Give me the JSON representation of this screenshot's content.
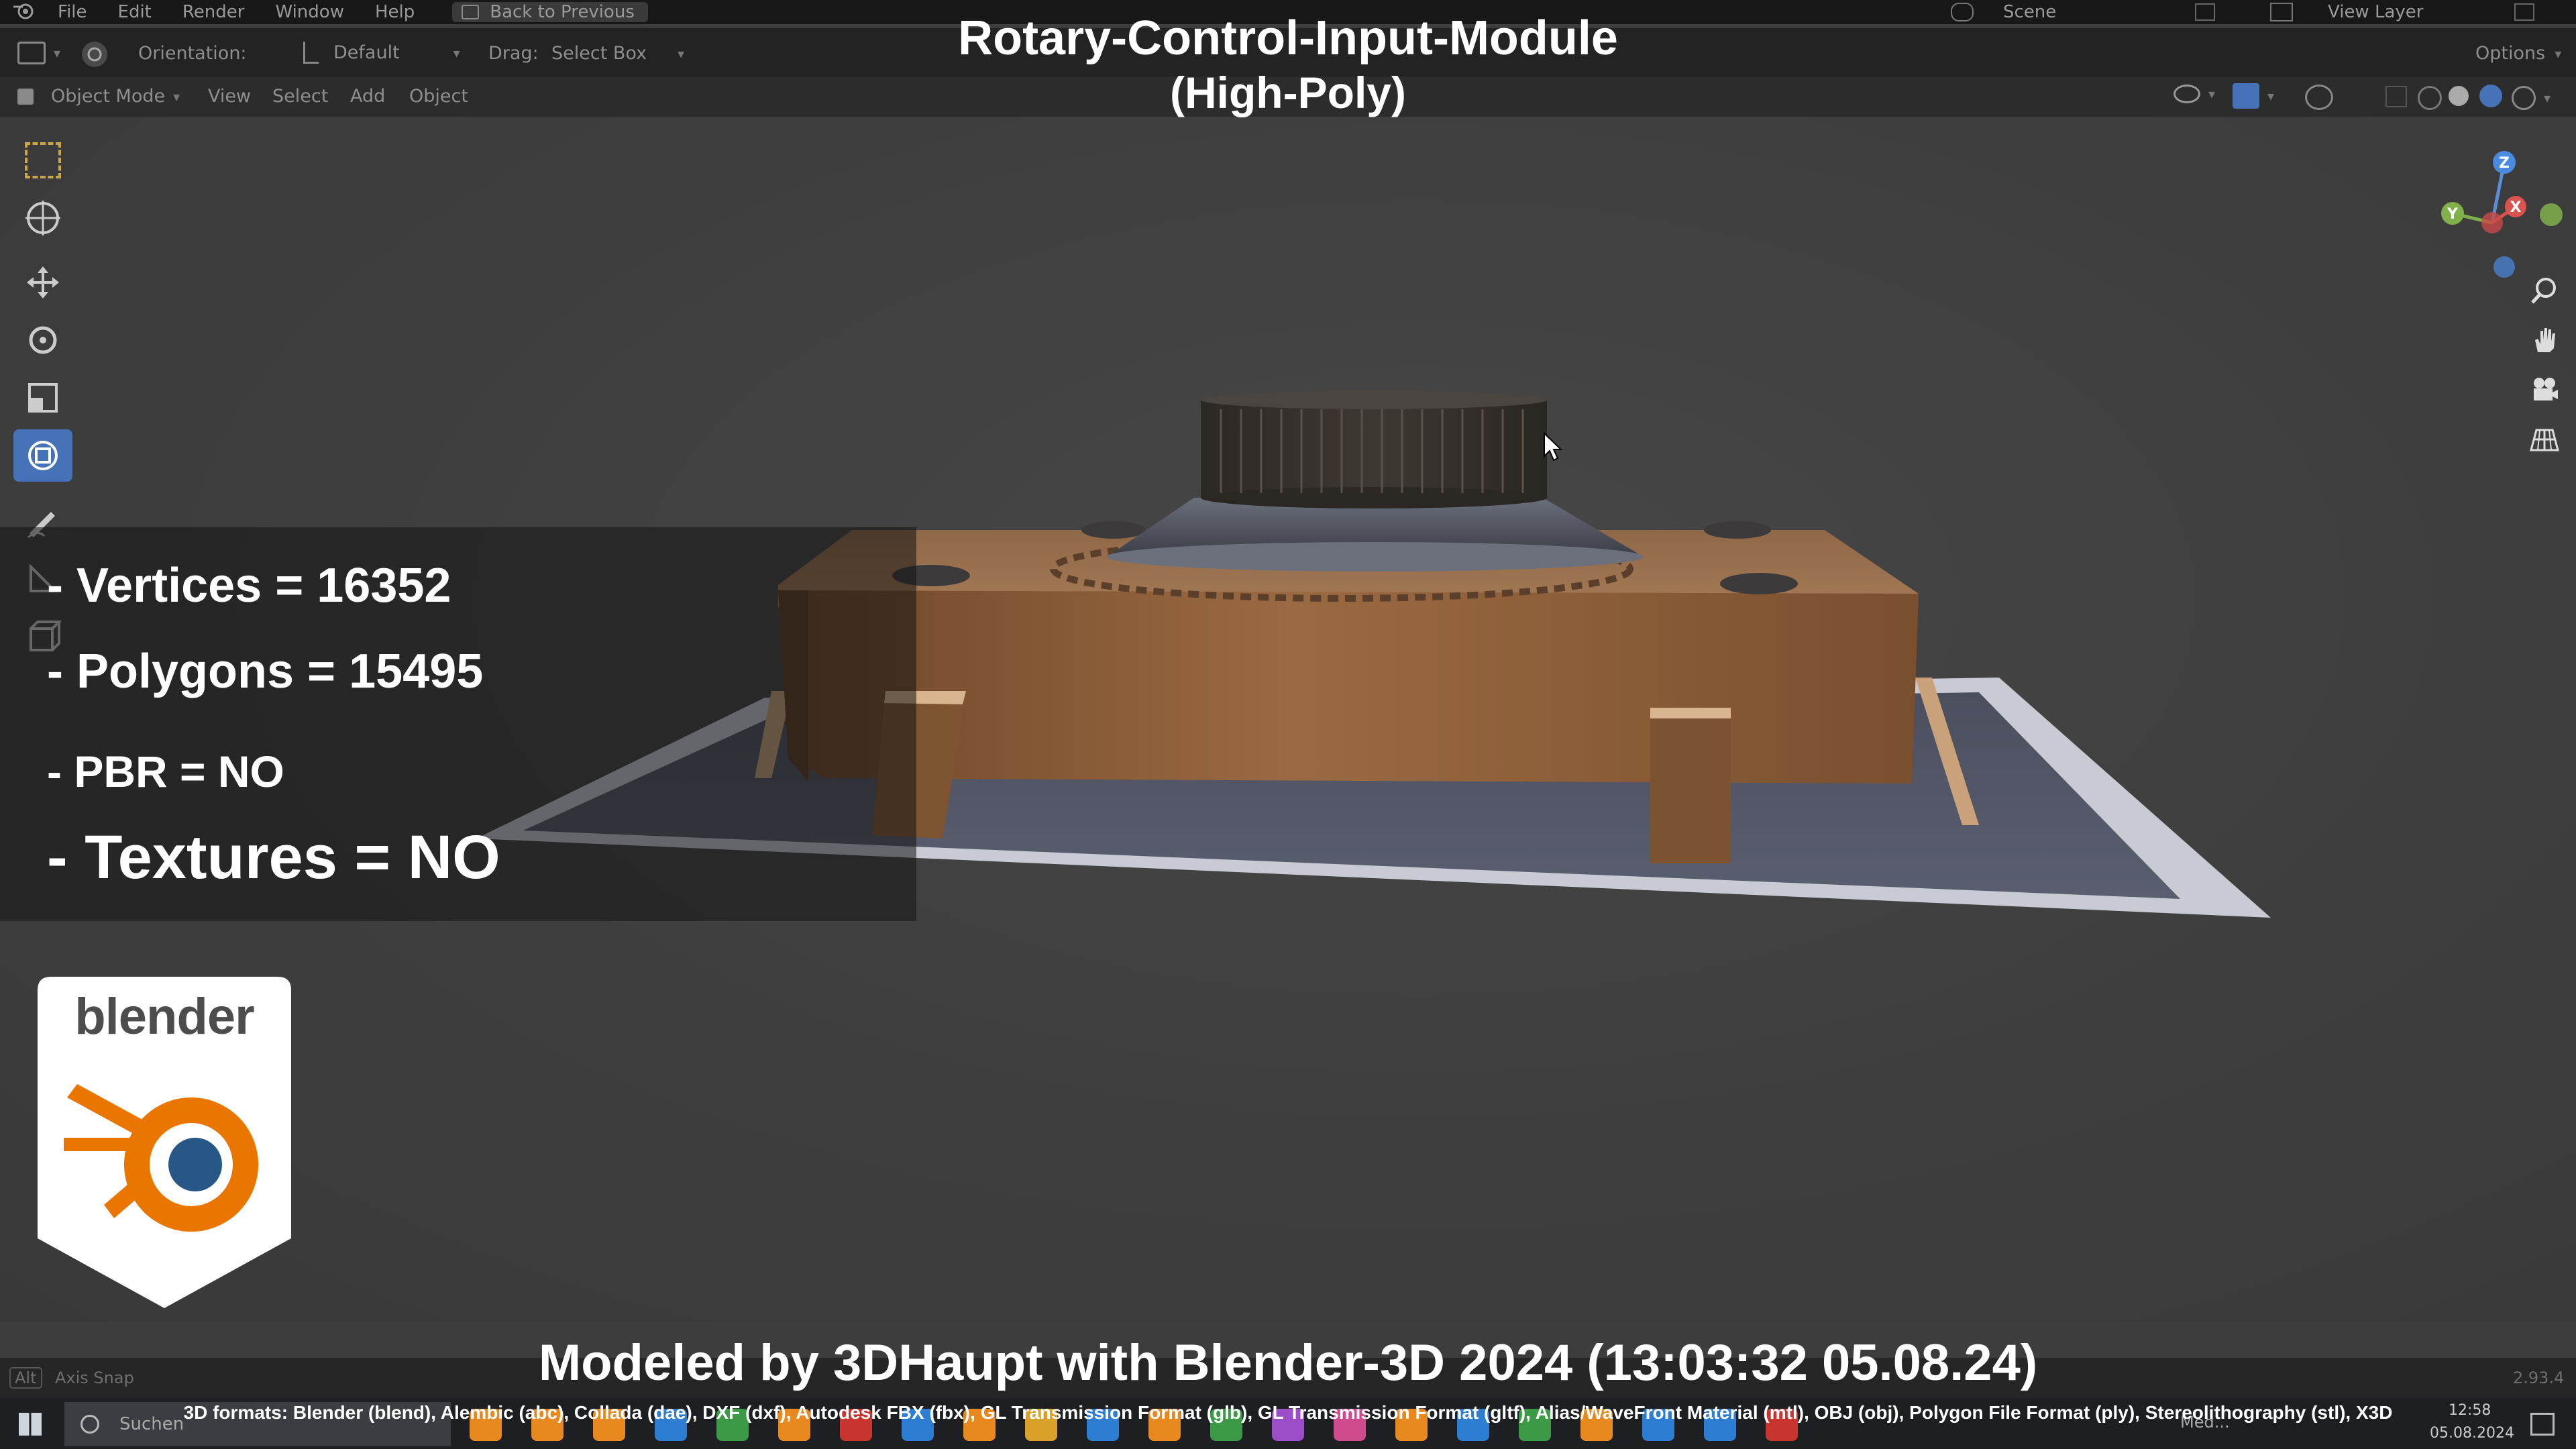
{
  "menu": {
    "items": [
      "File",
      "Edit",
      "Render",
      "Window",
      "Help"
    ],
    "back_label": "Back to Previous",
    "scene_label": "Scene",
    "view_layer_label": "View Layer"
  },
  "header": {
    "orientation_label": "Orientation:",
    "orientation_value": "Default",
    "drag_label": "Drag:",
    "drag_value": "Select Box",
    "options_label": "Options"
  },
  "mode_bar": {
    "mode": "Object Mode",
    "menus": [
      "View",
      "Select",
      "Add",
      "Object"
    ]
  },
  "overlay": {
    "title_line1": "Rotary-Control-Input-Module",
    "title_line2": "(High-Poly)",
    "vertices": "- Vertices = 16352",
    "polygons": "- Polygons = 15495",
    "pbr": "- PBR =  NO",
    "textures": "- Textures = NO",
    "logo_word": "blender",
    "credit": "Modeled by 3DHaupt with Blender-3D 2024 (13:03:32  05.08.24)",
    "formats": "3D formats: Blender (blend), Alembic (abc), Collada (dae), DXF (dxf), Autodesk FBX (fbx), GL Transmission Format (glb), GL Transmission Format (gltf), Alias/WaveFront Material (mtl), OBJ (obj), Polygon File Format (ply), Stereolithography (stl), X3D"
  },
  "gizmo": {
    "z": "Z",
    "y": "Y",
    "x": "X"
  },
  "status_bar": {
    "alt": "Alt",
    "hint": "Axis Snap",
    "version": "2.93.4"
  },
  "taskbar": {
    "search_placeholder": "Suchen",
    "time": "12:58",
    "date": "05.08.2024",
    "window_label": "Med..."
  },
  "colors": {
    "accent": "#4672b8",
    "blender_orange": "#ea7600",
    "blender_blue": "#265787",
    "model_body": "#8a5a35"
  }
}
